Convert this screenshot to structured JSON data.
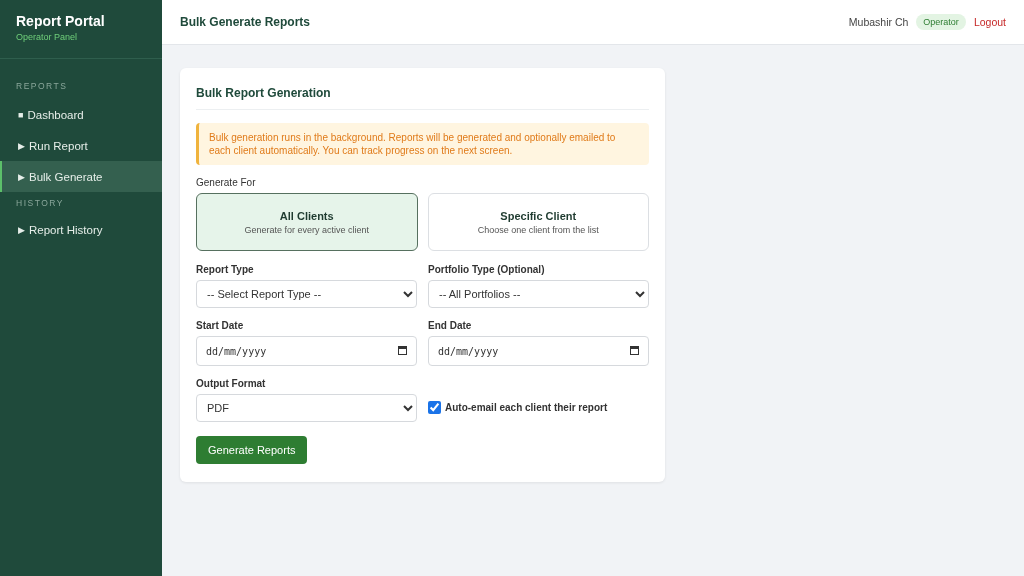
{
  "sidebar": {
    "brand": "Report Portal",
    "subtitle": "Operator Panel",
    "sections": [
      {
        "heading": "REPORTS",
        "items": [
          {
            "icon": "■",
            "label": "Dashboard",
            "selected": false
          },
          {
            "icon": "▶",
            "label": "Run Report",
            "selected": false
          },
          {
            "icon": "▶",
            "label": "Bulk Generate",
            "selected": true
          }
        ]
      },
      {
        "heading": "HISTORY",
        "items": [
          {
            "icon": "▶",
            "label": "Report History",
            "selected": false
          }
        ]
      }
    ]
  },
  "topbar": {
    "title": "Bulk Generate Reports",
    "user": "Mubashir Ch",
    "role": "Operator",
    "logout": "Logout"
  },
  "card": {
    "title": "Bulk Report Generation",
    "notice": "Bulk generation runs in the background. Reports will be generated and optionally emailed to each client automatically. You can track progress on the next screen.",
    "generate_for": {
      "label": "Generate For",
      "options": [
        {
          "title": "All Clients",
          "description": "Generate for every active client",
          "selected": true
        },
        {
          "title": "Specific Client",
          "description": "Choose one client from the list",
          "selected": false
        }
      ]
    },
    "fields": [
      {
        "kind": "select",
        "label": "Report Type",
        "value": "-- Select Report Type --"
      },
      {
        "kind": "select",
        "label": "Portfolio Type (Optional)",
        "value": "-- All Portfolios --"
      },
      {
        "kind": "date",
        "label": "Start Date",
        "placeholder": "dd/mm/yyyy"
      },
      {
        "kind": "date",
        "label": "End Date",
        "placeholder": "dd/mm/yyyy"
      },
      {
        "kind": "select",
        "label": "Output Format",
        "value": "PDF"
      },
      {
        "kind": "checkbox",
        "label": "Auto-email each client their report",
        "checked": true
      }
    ],
    "submit": "Generate Reports"
  }
}
